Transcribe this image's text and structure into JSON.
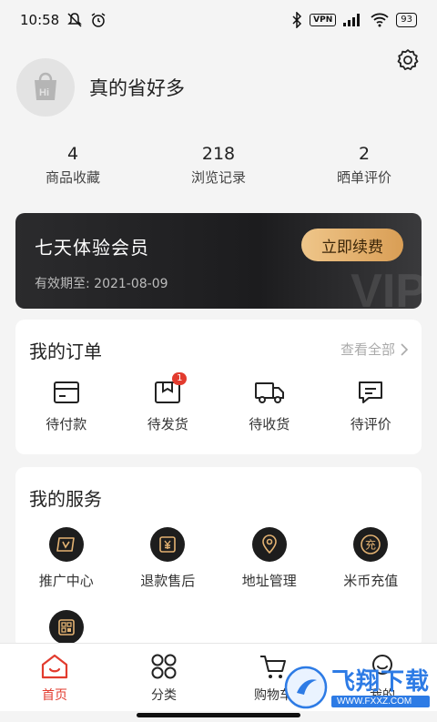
{
  "status_bar": {
    "time": "10:58",
    "vpn": "VPN",
    "battery": "93"
  },
  "profile": {
    "username": "真的省好多",
    "avatar_text": "Hi"
  },
  "stats": [
    {
      "value": "4",
      "label": "商品收藏"
    },
    {
      "value": "218",
      "label": "浏览记录"
    },
    {
      "value": "2",
      "label": "晒单评价"
    }
  ],
  "vip": {
    "title": "七天体验会员",
    "expiry": "有效期至: 2021-08-09",
    "renew_label": "立即续费",
    "watermark": "VIP"
  },
  "orders": {
    "title": "我的订单",
    "view_all": "查看全部",
    "items": [
      {
        "label": "待付款",
        "icon": "wallet-icon"
      },
      {
        "label": "待发货",
        "icon": "package-icon",
        "badge": "1"
      },
      {
        "label": "待收货",
        "icon": "truck-icon"
      },
      {
        "label": "待评价",
        "icon": "comment-icon"
      }
    ]
  },
  "services": {
    "title": "我的服务",
    "items": [
      {
        "label": "推广中心",
        "icon": "promo-icon"
      },
      {
        "label": "退款售后",
        "icon": "refund-icon"
      },
      {
        "label": "地址管理",
        "icon": "location-icon"
      },
      {
        "label": "米币充值",
        "icon": "recharge-icon",
        "glyph": "充"
      },
      {
        "label": "",
        "icon": "qrcode-icon"
      }
    ]
  },
  "tabs": [
    {
      "label": "首页",
      "icon": "home-icon",
      "active": true
    },
    {
      "label": "分类",
      "icon": "grid-icon"
    },
    {
      "label": "购物车",
      "icon": "cart-icon"
    },
    {
      "label": "我的",
      "icon": "user-icon"
    }
  ],
  "watermark": {
    "brand": "飞翔下载",
    "url": "WWW.FXXZ.COM"
  },
  "colors": {
    "accent": "#e23b2e",
    "vip_gold": "#e3b272",
    "card_dark": "#1f1f21"
  }
}
